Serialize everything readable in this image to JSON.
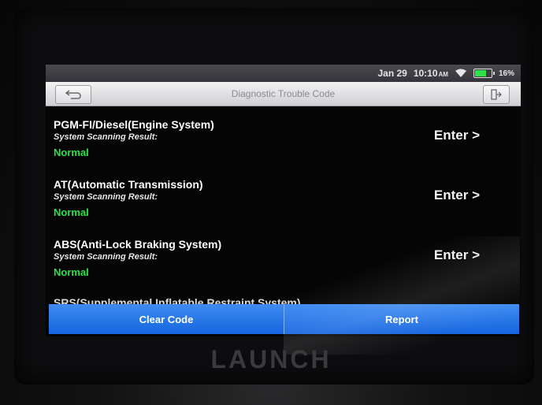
{
  "device": {
    "brand": "LAUNCH"
  },
  "statusbar": {
    "date": "Jan 29",
    "time": "10:10",
    "ampm": "AM",
    "battery": "16%",
    "battery_color": "#2ee04a"
  },
  "header": {
    "title": "Diagnostic Trouble Code",
    "back_icon": "back-arrow-icon",
    "exit_icon": "exit-icon"
  },
  "systems": [
    {
      "name": "PGM-FI/Diesel(Engine System)",
      "result_label": "System Scanning Result:",
      "status": "Normal",
      "action": "Enter >"
    },
    {
      "name": "AT(Automatic Transmission)",
      "result_label": "System Scanning Result:",
      "status": "Normal",
      "action": "Enter >"
    },
    {
      "name": "ABS(Anti-Lock Braking System)",
      "result_label": "System Scanning Result:",
      "status": "Normal",
      "action": "Enter >"
    }
  ],
  "partial_system": {
    "name": "SRS(Supplemental Inflatable Restraint System)"
  },
  "actions": {
    "clear_code": "Clear Code",
    "report": "Report"
  },
  "colors": {
    "status_normal": "#2ee04a",
    "action_bar": "#1a6fe6"
  }
}
